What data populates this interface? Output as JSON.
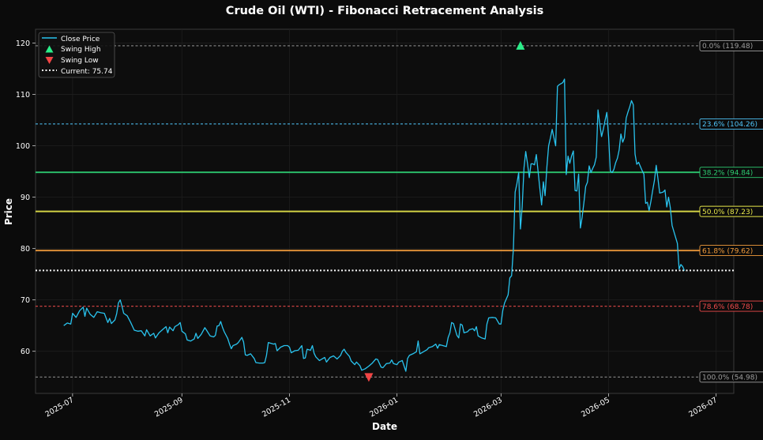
{
  "chart_data": {
    "type": "line",
    "title": "Crude Oil (WTI) - Fibonacci Retracement Analysis",
    "xlabel": "Date",
    "ylabel": "Price",
    "x_ticks": [
      "2025-07",
      "2025-09",
      "2025-11",
      "2026-01",
      "2026-03",
      "2026-05",
      "2026-07"
    ],
    "x_tick_days": [
      0,
      62,
      123,
      184,
      243,
      304,
      365
    ],
    "xlim_days": [
      -21,
      375
    ],
    "y_ticks": [
      60,
      70,
      80,
      90,
      100,
      110,
      120
    ],
    "ylim": [
      51.8,
      122.7
    ],
    "grid": true,
    "legend_position": "top-left",
    "legend": [
      {
        "key": "close",
        "label": "Close Price"
      },
      {
        "key": "high",
        "label": "Swing High"
      },
      {
        "key": "low",
        "label": "Swing Low"
      },
      {
        "key": "current",
        "label": "Current: 75.74"
      }
    ],
    "series_close": {
      "name": "Close Price",
      "color": "#29c3ee",
      "points": [
        [
          -5,
          65.0
        ],
        [
          -3,
          65.5
        ],
        [
          -1,
          65.3
        ],
        [
          0,
          67.4
        ],
        [
          2,
          66.6
        ],
        [
          4,
          67.9
        ],
        [
          6,
          68.6
        ],
        [
          7,
          66.8
        ],
        [
          8,
          68.4
        ],
        [
          10,
          67.2
        ],
        [
          12,
          66.6
        ],
        [
          14,
          67.7
        ],
        [
          16,
          67.5
        ],
        [
          18,
          67.4
        ],
        [
          20,
          65.6
        ],
        [
          21,
          66.4
        ],
        [
          22,
          65.4
        ],
        [
          24,
          66.1
        ],
        [
          25,
          67.3
        ],
        [
          26,
          69.4
        ],
        [
          27,
          70.0
        ],
        [
          28,
          68.8
        ],
        [
          29,
          67.4
        ],
        [
          31,
          66.9
        ],
        [
          33,
          65.6
        ],
        [
          35,
          64.1
        ],
        [
          37,
          63.9
        ],
        [
          39,
          64.0
        ],
        [
          41,
          63.0
        ],
        [
          42,
          64.2
        ],
        [
          44,
          63.0
        ],
        [
          46,
          63.5
        ],
        [
          47,
          62.6
        ],
        [
          49,
          63.6
        ],
        [
          51,
          64.2
        ],
        [
          53,
          64.8
        ],
        [
          54,
          63.6
        ],
        [
          55,
          64.7
        ],
        [
          57,
          64.0
        ],
        [
          58,
          64.8
        ],
        [
          60,
          65.2
        ],
        [
          61,
          65.6
        ],
        [
          62,
          63.9
        ],
        [
          64,
          63.4
        ],
        [
          65,
          62.2
        ],
        [
          67,
          62.0
        ],
        [
          69,
          62.4
        ],
        [
          70,
          63.5
        ],
        [
          71,
          62.5
        ],
        [
          73,
          63.3
        ],
        [
          75,
          64.6
        ],
        [
          76,
          64.1
        ],
        [
          78,
          63.0
        ],
        [
          80,
          62.8
        ],
        [
          81,
          63.1
        ],
        [
          82,
          64.9
        ],
        [
          83,
          65.0
        ],
        [
          84,
          65.8
        ],
        [
          85,
          64.7
        ],
        [
          86,
          63.8
        ],
        [
          88,
          62.5
        ],
        [
          89,
          61.4
        ],
        [
          90,
          60.5
        ],
        [
          91,
          61.1
        ],
        [
          93,
          61.4
        ],
        [
          94,
          61.7
        ],
        [
          96,
          62.7
        ],
        [
          97,
          61.8
        ],
        [
          98,
          59.3
        ],
        [
          99,
          59.2
        ],
        [
          101,
          59.5
        ],
        [
          103,
          58.6
        ],
        [
          104,
          57.8
        ],
        [
          106,
          57.7
        ],
        [
          108,
          57.7
        ],
        [
          109,
          57.8
        ],
        [
          110,
          59.2
        ],
        [
          111,
          61.7
        ],
        [
          112,
          61.6
        ],
        [
          114,
          61.4
        ],
        [
          115,
          61.5
        ],
        [
          116,
          60.1
        ],
        [
          118,
          60.8
        ],
        [
          120,
          61.1
        ],
        [
          122,
          61.1
        ],
        [
          123,
          60.8
        ],
        [
          124,
          59.7
        ],
        [
          126,
          60.1
        ],
        [
          128,
          60.2
        ],
        [
          130,
          61.1
        ],
        [
          131,
          58.6
        ],
        [
          132,
          58.7
        ],
        [
          133,
          60.4
        ],
        [
          135,
          60.2
        ],
        [
          136,
          61.1
        ],
        [
          137,
          59.6
        ],
        [
          138,
          58.9
        ],
        [
          140,
          58.2
        ],
        [
          141,
          58.4
        ],
        [
          143,
          58.8
        ],
        [
          144,
          57.9
        ],
        [
          146,
          58.8
        ],
        [
          148,
          59.1
        ],
        [
          150,
          58.5
        ],
        [
          152,
          59.2
        ],
        [
          153,
          60.0
        ],
        [
          154,
          60.4
        ],
        [
          155,
          59.8
        ],
        [
          157,
          59.0
        ],
        [
          158,
          58.1
        ],
        [
          160,
          57.4
        ],
        [
          161,
          57.9
        ],
        [
          163,
          57.2
        ],
        [
          164,
          56.3
        ],
        [
          166,
          56.6
        ],
        [
          168,
          57.1
        ],
        [
          170,
          57.7
        ],
        [
          172,
          58.5
        ],
        [
          173,
          58.4
        ],
        [
          175,
          56.9
        ],
        [
          176,
          56.8
        ],
        [
          178,
          57.6
        ],
        [
          180,
          57.7
        ],
        [
          181,
          58.3
        ],
        [
          182,
          57.6
        ],
        [
          184,
          57.4
        ],
        [
          185,
          57.9
        ],
        [
          187,
          58.2
        ],
        [
          189,
          56.1
        ],
        [
          190,
          58.6
        ],
        [
          191,
          59.2
        ],
        [
          193,
          59.5
        ],
        [
          195,
          59.9
        ],
        [
          196,
          62.0
        ],
        [
          197,
          59.5
        ],
        [
          199,
          59.9
        ],
        [
          201,
          60.3
        ],
        [
          202,
          60.7
        ],
        [
          204,
          60.9
        ],
        [
          206,
          61.4
        ],
        [
          207,
          60.6
        ],
        [
          208,
          61.3
        ],
        [
          210,
          61.1
        ],
        [
          212,
          60.9
        ],
        [
          213,
          62.7
        ],
        [
          214,
          63.6
        ],
        [
          215,
          65.6
        ],
        [
          216,
          65.4
        ],
        [
          218,
          63.1
        ],
        [
          219,
          62.6
        ],
        [
          220,
          65.3
        ],
        [
          221,
          65.1
        ],
        [
          222,
          63.6
        ],
        [
          224,
          63.8
        ],
        [
          225,
          64.2
        ],
        [
          227,
          64.4
        ],
        [
          228,
          64.0
        ],
        [
          229,
          64.8
        ],
        [
          230,
          63.0
        ],
        [
          232,
          62.6
        ],
        [
          234,
          62.4
        ],
        [
          235,
          65.3
        ],
        [
          236,
          66.5
        ],
        [
          238,
          66.6
        ],
        [
          240,
          66.5
        ],
        [
          242,
          65.3
        ],
        [
          243,
          65.3
        ],
        [
          244,
          68.0
        ],
        [
          245,
          69.4
        ],
        [
          247,
          71.0
        ],
        [
          248,
          74.3
        ],
        [
          249,
          74.7
        ],
        [
          250,
          80.0
        ],
        [
          251,
          91.0
        ],
        [
          252,
          92.6
        ],
        [
          253,
          94.8
        ],
        [
          254,
          83.8
        ],
        [
          255,
          88.1
        ],
        [
          256,
          95.7
        ],
        [
          257,
          98.9
        ],
        [
          258,
          96.6
        ],
        [
          259,
          93.8
        ],
        [
          260,
          96.5
        ],
        [
          261,
          96.5
        ],
        [
          262,
          96.3
        ],
        [
          263,
          98.3
        ],
        [
          264,
          95.1
        ],
        [
          265,
          91.8
        ],
        [
          266,
          88.5
        ],
        [
          267,
          93.0
        ],
        [
          268,
          90.3
        ],
        [
          269,
          95.9
        ],
        [
          270,
          100.0
        ],
        [
          271,
          101.5
        ],
        [
          272,
          103.2
        ],
        [
          273,
          101.6
        ],
        [
          274,
          100.0
        ],
        [
          275,
          111.6
        ],
        [
          276,
          111.9
        ],
        [
          277,
          112.1
        ],
        [
          278,
          112.3
        ],
        [
          279,
          113.0
        ],
        [
          280,
          94.4
        ],
        [
          281,
          98.0
        ],
        [
          282,
          96.6
        ],
        [
          283,
          98.0
        ],
        [
          284,
          99.0
        ],
        [
          285,
          91.3
        ],
        [
          286,
          91.2
        ],
        [
          287,
          94.5
        ],
        [
          288,
          84.0
        ],
        [
          289,
          86.1
        ],
        [
          290,
          89.0
        ],
        [
          291,
          92.1
        ],
        [
          292,
          92.9
        ],
        [
          293,
          96.1
        ],
        [
          294,
          94.8
        ],
        [
          295,
          95.6
        ],
        [
          296,
          96.3
        ],
        [
          297,
          97.8
        ],
        [
          298,
          107.0
        ],
        [
          299,
          104.3
        ],
        [
          300,
          101.8
        ],
        [
          301,
          103.2
        ],
        [
          302,
          104.9
        ],
        [
          303,
          106.5
        ],
        [
          304,
          101.8
        ],
        [
          305,
          95.1
        ],
        [
          306,
          94.8
        ],
        [
          307,
          95.4
        ],
        [
          308,
          96.7
        ],
        [
          309,
          97.6
        ],
        [
          310,
          99.2
        ],
        [
          311,
          102.3
        ],
        [
          312,
          100.7
        ],
        [
          313,
          101.6
        ],
        [
          314,
          105.4
        ],
        [
          315,
          106.6
        ],
        [
          316,
          107.6
        ],
        [
          317,
          108.8
        ],
        [
          318,
          108.0
        ],
        [
          319,
          98.4
        ],
        [
          320,
          96.4
        ],
        [
          321,
          96.8
        ],
        [
          322,
          96.0
        ],
        [
          323,
          95.2
        ],
        [
          324,
          94.5
        ],
        [
          325,
          88.8
        ],
        [
          326,
          89.0
        ],
        [
          327,
          87.4
        ],
        [
          328,
          89.2
        ],
        [
          329,
          91.3
        ],
        [
          330,
          93.2
        ],
        [
          331,
          96.2
        ],
        [
          332,
          93.6
        ],
        [
          333,
          90.8
        ],
        [
          334,
          90.9
        ],
        [
          335,
          91.0
        ],
        [
          336,
          91.4
        ],
        [
          337,
          88.1
        ],
        [
          338,
          90.0
        ],
        [
          339,
          88.0
        ],
        [
          340,
          84.5
        ],
        [
          342,
          82.2
        ],
        [
          343,
          81.0
        ],
        [
          344,
          76.0
        ],
        [
          345,
          76.9
        ],
        [
          346,
          76.5
        ],
        [
          347,
          75.7
        ]
      ]
    },
    "swing_high": {
      "day": 254,
      "value": 119.48,
      "color": "#2bef8a"
    },
    "swing_low": {
      "day": 168,
      "value": 54.98,
      "color": "#f24545"
    },
    "current": {
      "value": 75.74,
      "color": "#ffffff"
    },
    "fib_levels": [
      {
        "label": "0.0% (119.48)",
        "value": 119.48,
        "color": "#9e9e9e",
        "style": "dashed",
        "width": 1.2
      },
      {
        "label": "23.6% (104.26)",
        "value": 104.26,
        "color": "#4fc3f7",
        "style": "dashed",
        "width": 1.2
      },
      {
        "label": "38.2% (94.84)",
        "value": 94.84,
        "color": "#2ecc71",
        "style": "solid",
        "width": 2
      },
      {
        "label": "50.0% (87.23)",
        "value": 87.23,
        "color": "#e8e84a",
        "style": "solid",
        "width": 2
      },
      {
        "label": "61.8% (79.62)",
        "value": 79.62,
        "color": "#f39c3c",
        "style": "solid",
        "width": 2
      },
      {
        "label": "78.6% (68.78)",
        "value": 68.78,
        "color": "#f04b4b",
        "style": "dashed",
        "width": 1.2
      },
      {
        "label": "100.0% (54.98)",
        "value": 54.98,
        "color": "#9e9e9e",
        "style": "dashed",
        "width": 1.2
      }
    ]
  }
}
